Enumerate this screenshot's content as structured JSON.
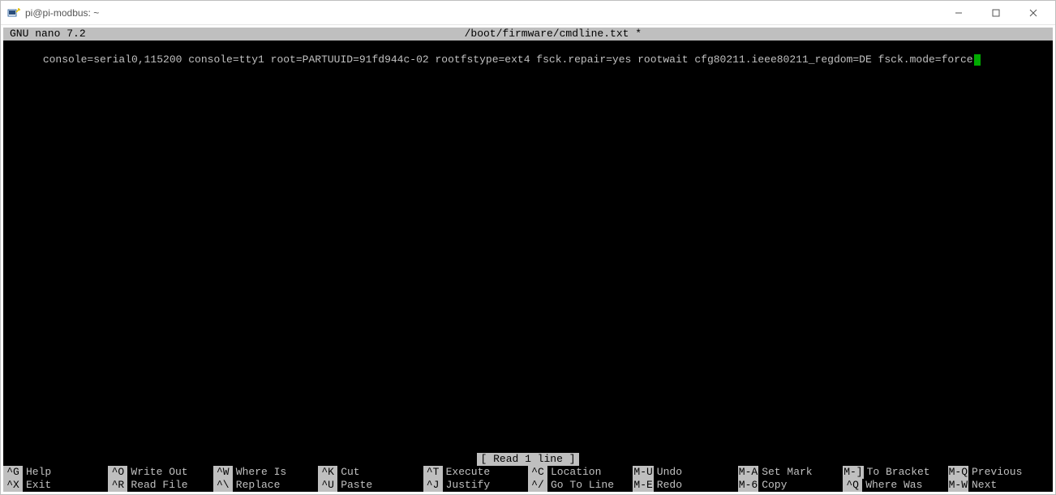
{
  "window": {
    "title": "pi@pi-modbus: ~"
  },
  "nano": {
    "app_name": "GNU nano 7.2",
    "file_path": "/boot/firmware/cmdline.txt *",
    "content_line": "console=serial0,115200 console=tty1 root=PARTUUID=91fd944c-02 rootfstype=ext4 fsck.repair=yes rootwait cfg80211.ieee80211_regdom=DE fsck.mode=force",
    "status": "[ Read 1 line ]"
  },
  "shortcuts": {
    "row1": [
      {
        "key": "^G",
        "label": "Help"
      },
      {
        "key": "^O",
        "label": "Write Out"
      },
      {
        "key": "^W",
        "label": "Where Is"
      },
      {
        "key": "^K",
        "label": "Cut"
      },
      {
        "key": "^T",
        "label": "Execute"
      },
      {
        "key": "^C",
        "label": "Location"
      },
      {
        "key": "M-U",
        "label": "Undo"
      },
      {
        "key": "M-A",
        "label": "Set Mark"
      },
      {
        "key": "M-]",
        "label": "To Bracket"
      },
      {
        "key": "M-Q",
        "label": "Previous"
      }
    ],
    "row2": [
      {
        "key": "^X",
        "label": "Exit"
      },
      {
        "key": "^R",
        "label": "Read File"
      },
      {
        "key": "^\\",
        "label": "Replace"
      },
      {
        "key": "^U",
        "label": "Paste"
      },
      {
        "key": "^J",
        "label": "Justify"
      },
      {
        "key": "^/",
        "label": "Go To Line"
      },
      {
        "key": "M-E",
        "label": "Redo"
      },
      {
        "key": "M-6",
        "label": "Copy"
      },
      {
        "key": "^Q",
        "label": "Where Was"
      },
      {
        "key": "M-W",
        "label": "Next"
      }
    ]
  }
}
